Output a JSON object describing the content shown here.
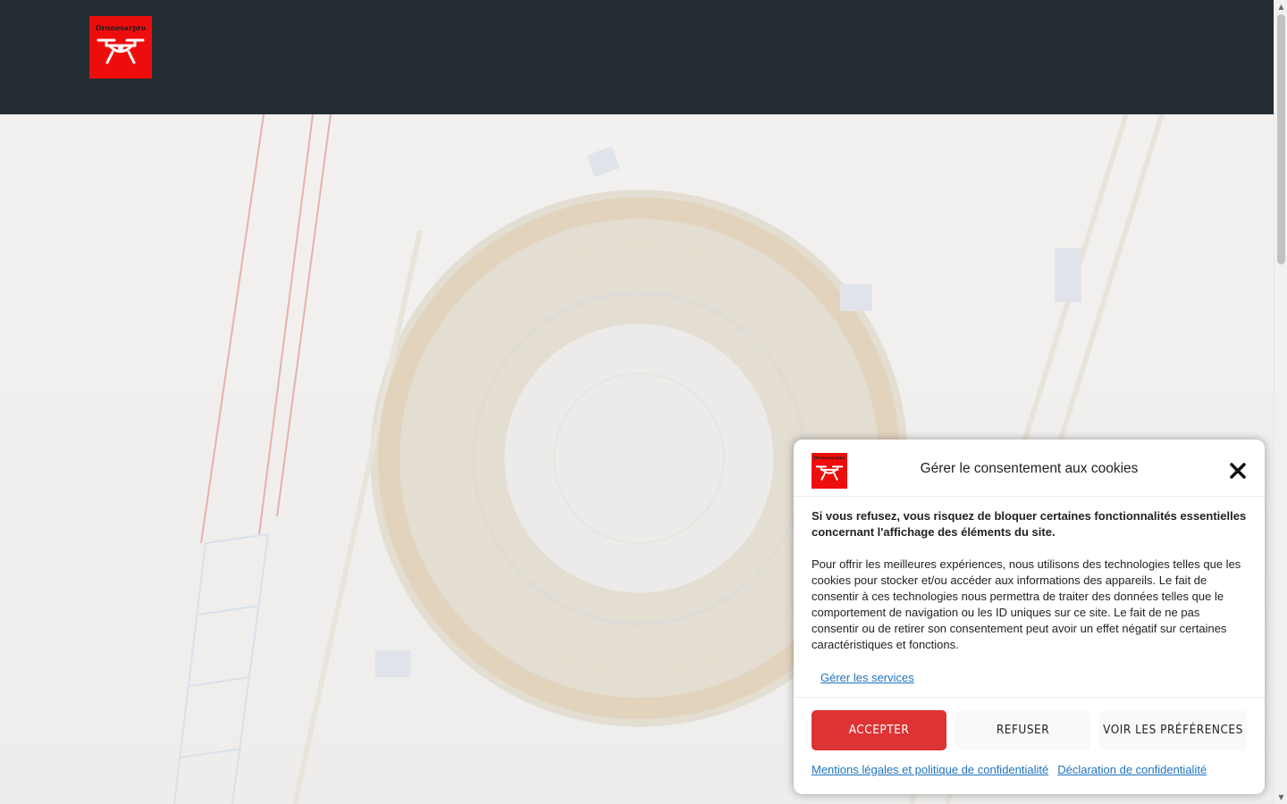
{
  "header": {
    "logo_text": "Dronesarpro"
  },
  "cookie_dialog": {
    "title": "Gérer le consentement aux cookies",
    "warning": "Si vous refusez, vous risquez de bloquer certaines fonctionnalités essentielles concernant l'affichage des éléments du site.",
    "description": "Pour offrir les meilleures expériences, nous utilisons des technologies telles que les cookies pour stocker et/ou accéder aux informations des appareils. Le fait de consentir à ces technologies nous permettra de traiter des données telles que le comportement de navigation ou les ID uniques sur ce site. Le fait de ne pas consentir ou de retirer son consentement peut avoir un effet négatif sur certaines caractéristiques et fonctions.",
    "manage_services": "Gérer les services",
    "accept_label": "Accepter",
    "refuse_label": "Refuser",
    "preferences_label": "Voir les préférences",
    "legal_link": "Mentions légales et politique de confidentialité",
    "privacy_link": "Déclaration de confidentialité",
    "close_icon": "close-icon"
  },
  "colors": {
    "header_bg": "#232d33",
    "brand_red": "#ee0d0d",
    "accept_bg": "#dd3333",
    "link": "#1e73be"
  }
}
